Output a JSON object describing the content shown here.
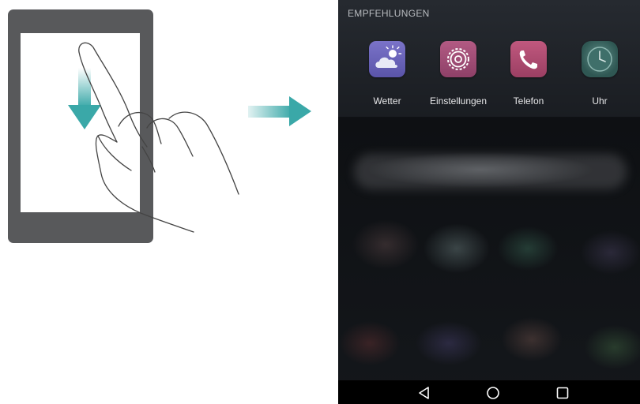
{
  "suggestions": {
    "title": "EMPFEHLUNGEN",
    "apps": [
      {
        "label": "Wetter",
        "icon": "weather-icon"
      },
      {
        "label": "Einstellungen",
        "icon": "settings-gear-icon"
      },
      {
        "label": "Telefon",
        "icon": "phone-handset-icon"
      },
      {
        "label": "Uhr",
        "icon": "clock-icon"
      }
    ]
  },
  "navbar": {
    "back_icon": "back-triangle-icon",
    "home_icon": "home-circle-icon",
    "recents_icon": "recents-square-icon"
  },
  "illustration": {
    "gesture": "swipe-down",
    "arrow_color": "#3aa8a8",
    "device_color": "#58595b"
  }
}
